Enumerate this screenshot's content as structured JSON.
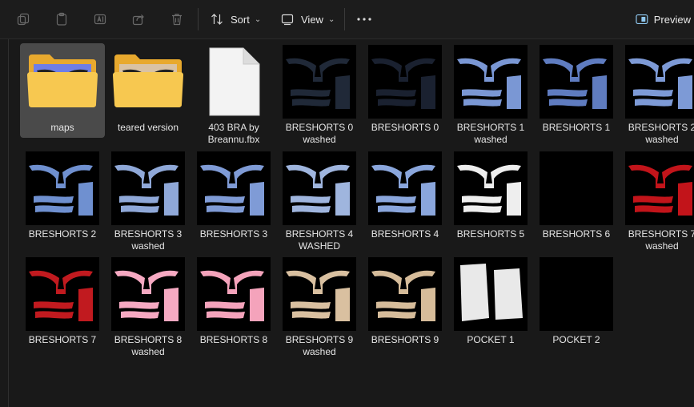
{
  "toolbar": {
    "sort_label": "Sort",
    "view_label": "View",
    "preview_label": "Preview"
  },
  "items": [
    {
      "name": "maps",
      "kind": "folder",
      "selected": true,
      "thumb_color": "#6f7ee6"
    },
    {
      "name": "teared version",
      "kind": "folder",
      "thumb_color": "#d9c2a4"
    },
    {
      "name": "403 BRA by\nBreannu.fbx",
      "kind": "file"
    },
    {
      "name": "BRESHORTS 0\nwashed",
      "kind": "texture",
      "color": "#3b4a66"
    },
    {
      "name": "BRESHORTS 0",
      "kind": "texture",
      "color": "#2f3d57"
    },
    {
      "name": "BRESHORTS 1\nwashed",
      "kind": "texture",
      "color": "#7a97d4"
    },
    {
      "name": "BRESHORTS 1",
      "kind": "texture",
      "color": "#5f7cc0"
    },
    {
      "name": "BRESHORTS 2\nwashed",
      "kind": "texture",
      "color": "#7d9ad6"
    },
    {
      "name": "BRESHORTS 2",
      "kind": "texture",
      "color": "#6f90d0"
    },
    {
      "name": "BRESHORTS 3\nwashed",
      "kind": "texture",
      "color": "#8fa8d8"
    },
    {
      "name": "BRESHORTS 3",
      "kind": "texture",
      "color": "#7f9bd6"
    },
    {
      "name": "BRESHORTS 4\nWASHED",
      "kind": "texture",
      "color": "#9fb5de"
    },
    {
      "name": "BRESHORTS 4",
      "kind": "texture",
      "color": "#8aa6dc"
    },
    {
      "name": "BRESHORTS 5",
      "kind": "texture",
      "color": "#eeeeee"
    },
    {
      "name": "BRESHORTS 6",
      "kind": "texture",
      "color": "#000000"
    },
    {
      "name": "BRESHORTS 7\nwashed",
      "kind": "texture",
      "color": "#c2141a"
    },
    {
      "name": "BRESHORTS 7",
      "kind": "texture",
      "color": "#c11a1f"
    },
    {
      "name": "BRESHORTS 8\nwashed",
      "kind": "texture",
      "color": "#f6a9c2"
    },
    {
      "name": "BRESHORTS 8",
      "kind": "texture",
      "color": "#f4a3bb"
    },
    {
      "name": "BRESHORTS 9\nwashed",
      "kind": "texture",
      "color": "#d9c0a0"
    },
    {
      "name": "BRESHORTS 9",
      "kind": "texture",
      "color": "#d6bc9a"
    },
    {
      "name": "POCKET 1",
      "kind": "pocket",
      "color": "#e9e9e9"
    },
    {
      "name": "POCKET 2",
      "kind": "texture",
      "color": "#000000"
    }
  ]
}
